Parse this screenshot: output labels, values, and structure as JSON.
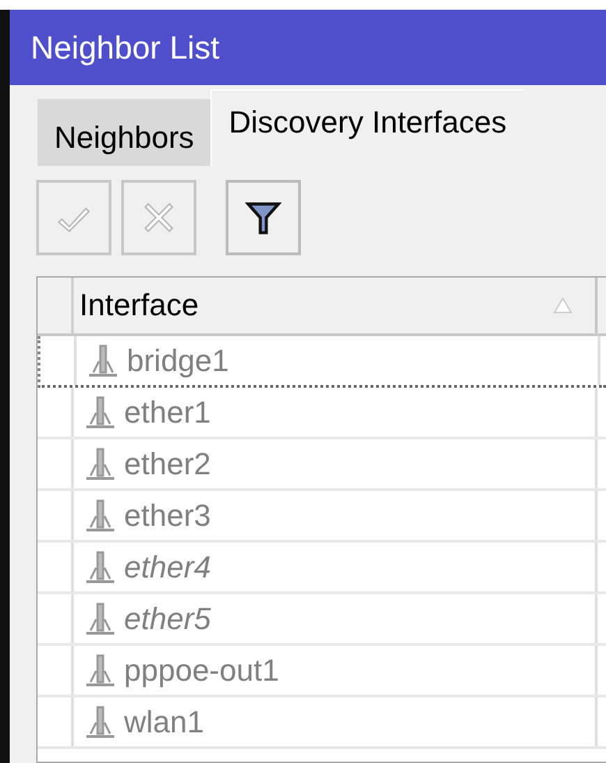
{
  "window": {
    "title": "Neighbor List"
  },
  "tabs": [
    {
      "label": "Neighbors",
      "selected": false
    },
    {
      "label": "Discovery Interfaces",
      "selected": true
    }
  ],
  "toolbar": [
    {
      "kind": "enable",
      "disabled": true
    },
    {
      "kind": "disable",
      "disabled": true
    },
    {
      "kind": "filter",
      "disabled": false
    }
  ],
  "table": {
    "columns": [
      {
        "label": "Interface",
        "sorted": true
      }
    ],
    "rows": [
      {
        "interface": "bridge1",
        "selected": true,
        "dynamic": false
      },
      {
        "interface": "ether1",
        "selected": false,
        "dynamic": false
      },
      {
        "interface": "ether2",
        "selected": false,
        "dynamic": false
      },
      {
        "interface": "ether3",
        "selected": false,
        "dynamic": false
      },
      {
        "interface": "ether4",
        "selected": false,
        "dynamic": true
      },
      {
        "interface": "ether5",
        "selected": false,
        "dynamic": true
      },
      {
        "interface": "pppoe-out1",
        "selected": false,
        "dynamic": false
      },
      {
        "interface": "wlan1",
        "selected": false,
        "dynamic": false
      }
    ]
  }
}
